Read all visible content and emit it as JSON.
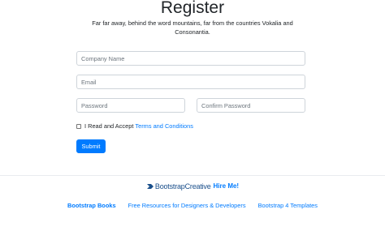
{
  "header": {
    "title": "Register",
    "subtitle": "Far far away, behind the word mountains, far from the countries Vokalia and Consonantia."
  },
  "form": {
    "company_placeholder": "Company Name",
    "email_placeholder": "Email",
    "password_placeholder": "Password",
    "confirm_password_placeholder": "Confirm Password",
    "checkbox_checked": false,
    "checkbox_label": "I Read and Accept",
    "terms_link": "Terms and Conditions",
    "submit_label": "Submit"
  },
  "footer": {
    "brand_icon": "bootstrap-creative-logo-icon",
    "brand_name": "BootstrapCreative",
    "hire_label": "Hire Me!",
    "links": [
      "Bootstrap Books",
      "Free Resources for Designers & Developers",
      "Bootstrap 4 Templates"
    ]
  },
  "colors": {
    "primary": "#007bff",
    "brand": "#1a4f8b",
    "border": "#ced4da"
  }
}
